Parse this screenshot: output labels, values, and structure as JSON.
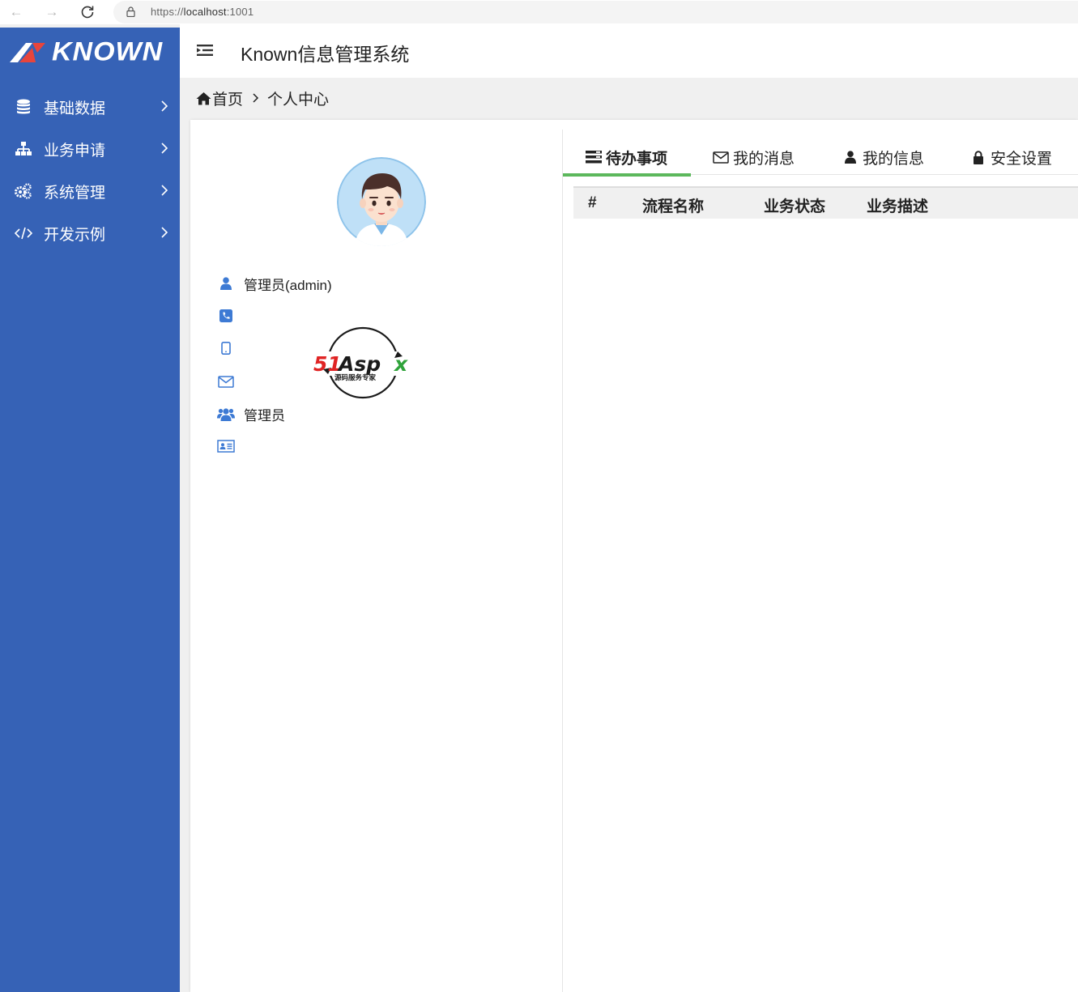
{
  "browser": {
    "url_scheme": "https://",
    "url_host": "localhost",
    "url_port": ":1001"
  },
  "sidebar": {
    "logo_text": "KNOWN",
    "items": [
      {
        "label": "基础数据",
        "icon": "database-icon"
      },
      {
        "label": "业务申请",
        "icon": "sitemap-icon"
      },
      {
        "label": "系统管理",
        "icon": "cogs-icon"
      },
      {
        "label": "开发示例",
        "icon": "code-icon"
      }
    ]
  },
  "header": {
    "title": "Known信息管理系统"
  },
  "breadcrumb": {
    "home": "首页",
    "current": "个人中心"
  },
  "profile": {
    "name": "管理员(admin)",
    "phone": "",
    "mobile": "",
    "email": "",
    "role": "管理员",
    "note": "",
    "watermark_main": "51Aspx",
    "watermark_sub": "源码服务专家"
  },
  "tabs": [
    {
      "label": "待办事项",
      "icon": "list-icon",
      "active": true
    },
    {
      "label": "我的消息",
      "icon": "envelope-icon",
      "active": false
    },
    {
      "label": "我的信息",
      "icon": "user-icon",
      "active": false
    },
    {
      "label": "安全设置",
      "icon": "lock-icon",
      "active": false
    }
  ],
  "table": {
    "columns": [
      "#",
      "流程名称",
      "业务状态",
      "业务描述"
    ],
    "rows": []
  },
  "colors": {
    "sidebar": "#3662b6",
    "active_tab_underline": "#5cb85c",
    "icon_blue": "#3d7ad4"
  }
}
